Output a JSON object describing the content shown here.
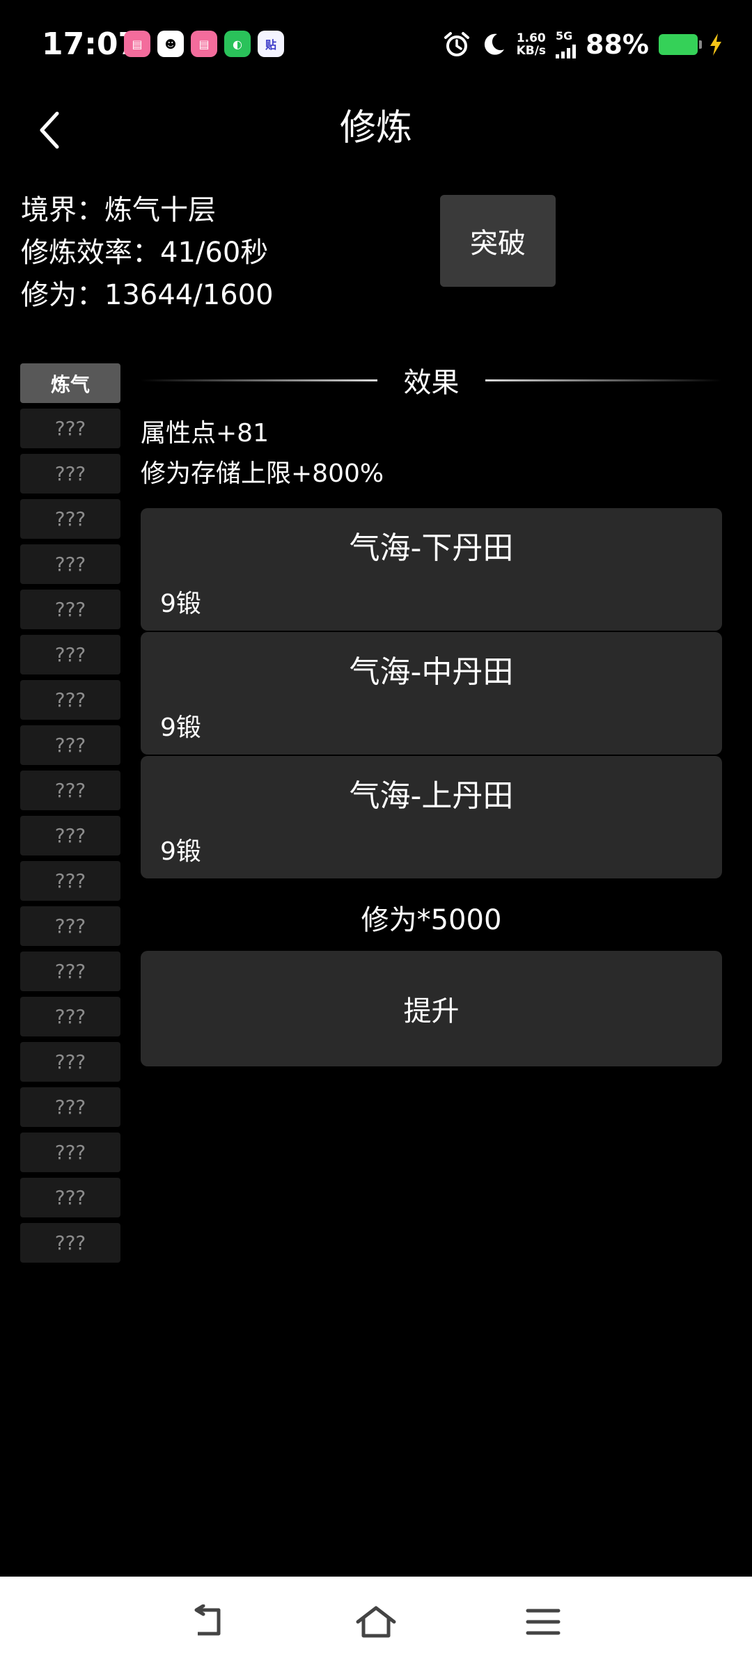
{
  "status_bar": {
    "time": "17:07",
    "apps": [
      "bilibili",
      "QQ",
      "bilibili",
      "WeChat",
      "贴"
    ],
    "net_speed_value": "1.60",
    "net_speed_unit": "KB/s",
    "network": "5G",
    "battery": "88%",
    "battery_color": "#35d158"
  },
  "header": {
    "title": "修炼"
  },
  "info": {
    "realm": "境界：炼气十层",
    "efficiency": "修炼效率：41/60秒",
    "cultivation": "修为：13644/1600"
  },
  "breakthrough_label": "突破",
  "sidebar": {
    "items": [
      {
        "label": "炼气",
        "active": true
      },
      {
        "label": "???"
      },
      {
        "label": "???"
      },
      {
        "label": "???"
      },
      {
        "label": "???"
      },
      {
        "label": "???"
      },
      {
        "label": "???"
      },
      {
        "label": "???"
      },
      {
        "label": "???"
      },
      {
        "label": "???"
      },
      {
        "label": "???"
      },
      {
        "label": "???"
      },
      {
        "label": "???"
      },
      {
        "label": "???"
      },
      {
        "label": "???"
      },
      {
        "label": "???"
      },
      {
        "label": "???"
      },
      {
        "label": "???"
      },
      {
        "label": "???"
      },
      {
        "label": "???"
      }
    ]
  },
  "effects": {
    "title": "效果",
    "lines": [
      "属性点+81",
      "修为存储上限+800%"
    ]
  },
  "cards": [
    {
      "title": "气海-下丹田",
      "level": "9锻"
    },
    {
      "title": "气海-中丹田",
      "level": "9锻"
    },
    {
      "title": "气海-上丹田",
      "level": "9锻"
    }
  ],
  "cost": "修为*5000",
  "upgrade_label": "提升",
  "colors": {
    "background": "#000000",
    "card": "#2a2a2a",
    "button": "#3a3a3a",
    "sidebar_active": "#585858",
    "sidebar_item": "#1b1b1b"
  },
  "navbar": {
    "buttons": [
      "back-icon",
      "home-icon",
      "menu-icon"
    ]
  }
}
